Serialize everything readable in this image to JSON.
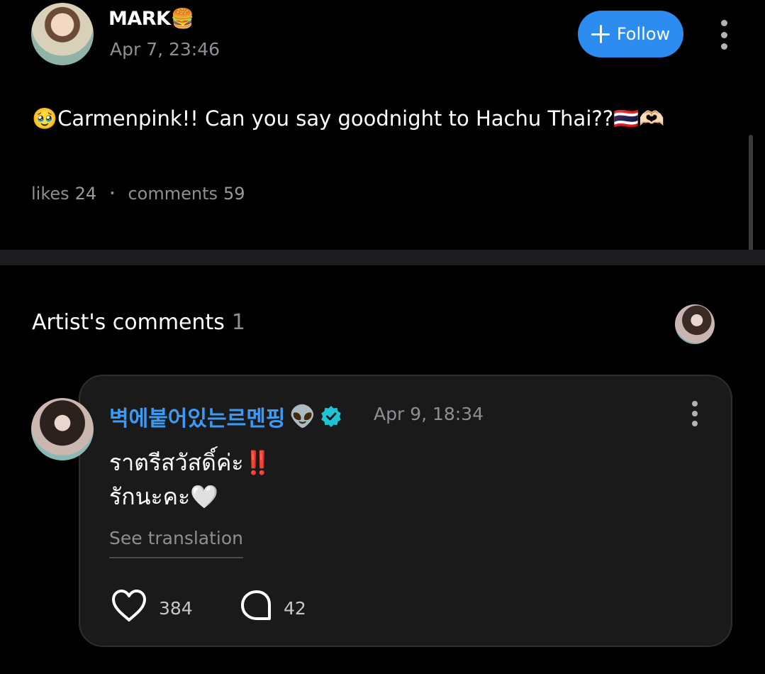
{
  "post": {
    "author": "MARK",
    "author_emoji": "🍔",
    "timestamp": "Apr 7, 23:46",
    "follow_label": "Follow",
    "body_emoji_lead": "🥹",
    "body_text": "Carmenpink!! Can you say goodnight to Hachu Thai??",
    "body_emoji_trail": "🇹🇭🫶🏻",
    "likes_label": "likes",
    "likes_count": "24",
    "comments_label": "comments",
    "comments_count": "59"
  },
  "artist_comments": {
    "title": "Artist's comments",
    "count": "1",
    "comment": {
      "author": "벽에붙어있는르멘핑",
      "author_emoji": "👽",
      "timestamp": "Apr 9, 18:34",
      "text": "ราตรีสวัสดิ์ค่ะ‼️\nรักนะคะ🤍",
      "see_translation": "See translation",
      "likes": "384",
      "replies": "42"
    }
  },
  "colors": {
    "accent": "#2d8cf0",
    "author_link": "#3b9af5",
    "verified": "#1fc3d6",
    "muted_text": "#8e8e93",
    "card_bg": "#1a1a1a"
  },
  "icons": [
    "plus-icon",
    "more-options-icon",
    "verified-badge-icon",
    "heart-icon",
    "reply-bubble-icon"
  ]
}
